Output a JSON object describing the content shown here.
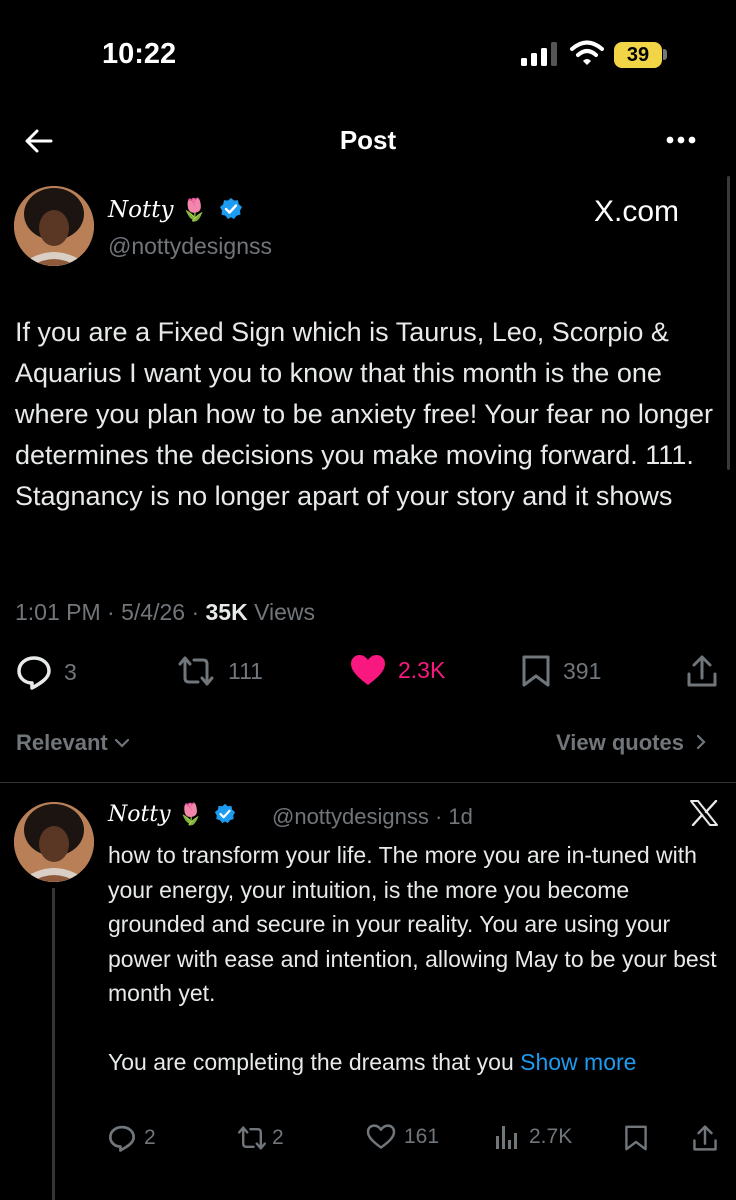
{
  "status_bar": {
    "time": "10:22",
    "battery": "39"
  },
  "nav": {
    "title": "Post"
  },
  "post": {
    "author_name": "Notty",
    "author_emoji": "🌷",
    "handle": "@nottydesignss",
    "source_label": "X.com",
    "text": "If you are a Fixed Sign which is Taurus, Leo, Scorpio & Aquarius I want you to know that this month is the one where you plan how to be anxiety free! Your fear no longer determines the decisions you make moving forward. 111. Stagnancy is no longer apart of your story and it shows",
    "time": "1:01 PM",
    "date": "5/4/26",
    "views_count": "35K",
    "views_label": "Views",
    "replies": "3",
    "reposts": "111",
    "likes": "2.3K",
    "bookmarks": "391"
  },
  "sort": {
    "relevant_label": "Relevant",
    "view_quotes_label": "View quotes"
  },
  "reply": {
    "author_name": "Notty",
    "author_emoji": "🌷",
    "handle_time": "@nottydesignss · 1d",
    "text_p1": "how to transform your life. The more you are in-tuned with your energy, your intuition, is the more you become grounded and secure in your reality. You are using your power with ease and intention, allowing May to be your best month yet.",
    "text_p2": "You are completing the dreams that you",
    "show_more": "Show more",
    "replies": "2",
    "reposts": "2",
    "likes": "161",
    "views": "2.7K"
  },
  "colors": {
    "like": "#f91880",
    "verified": "#1d9bf0",
    "link": "#1d9bf0"
  }
}
